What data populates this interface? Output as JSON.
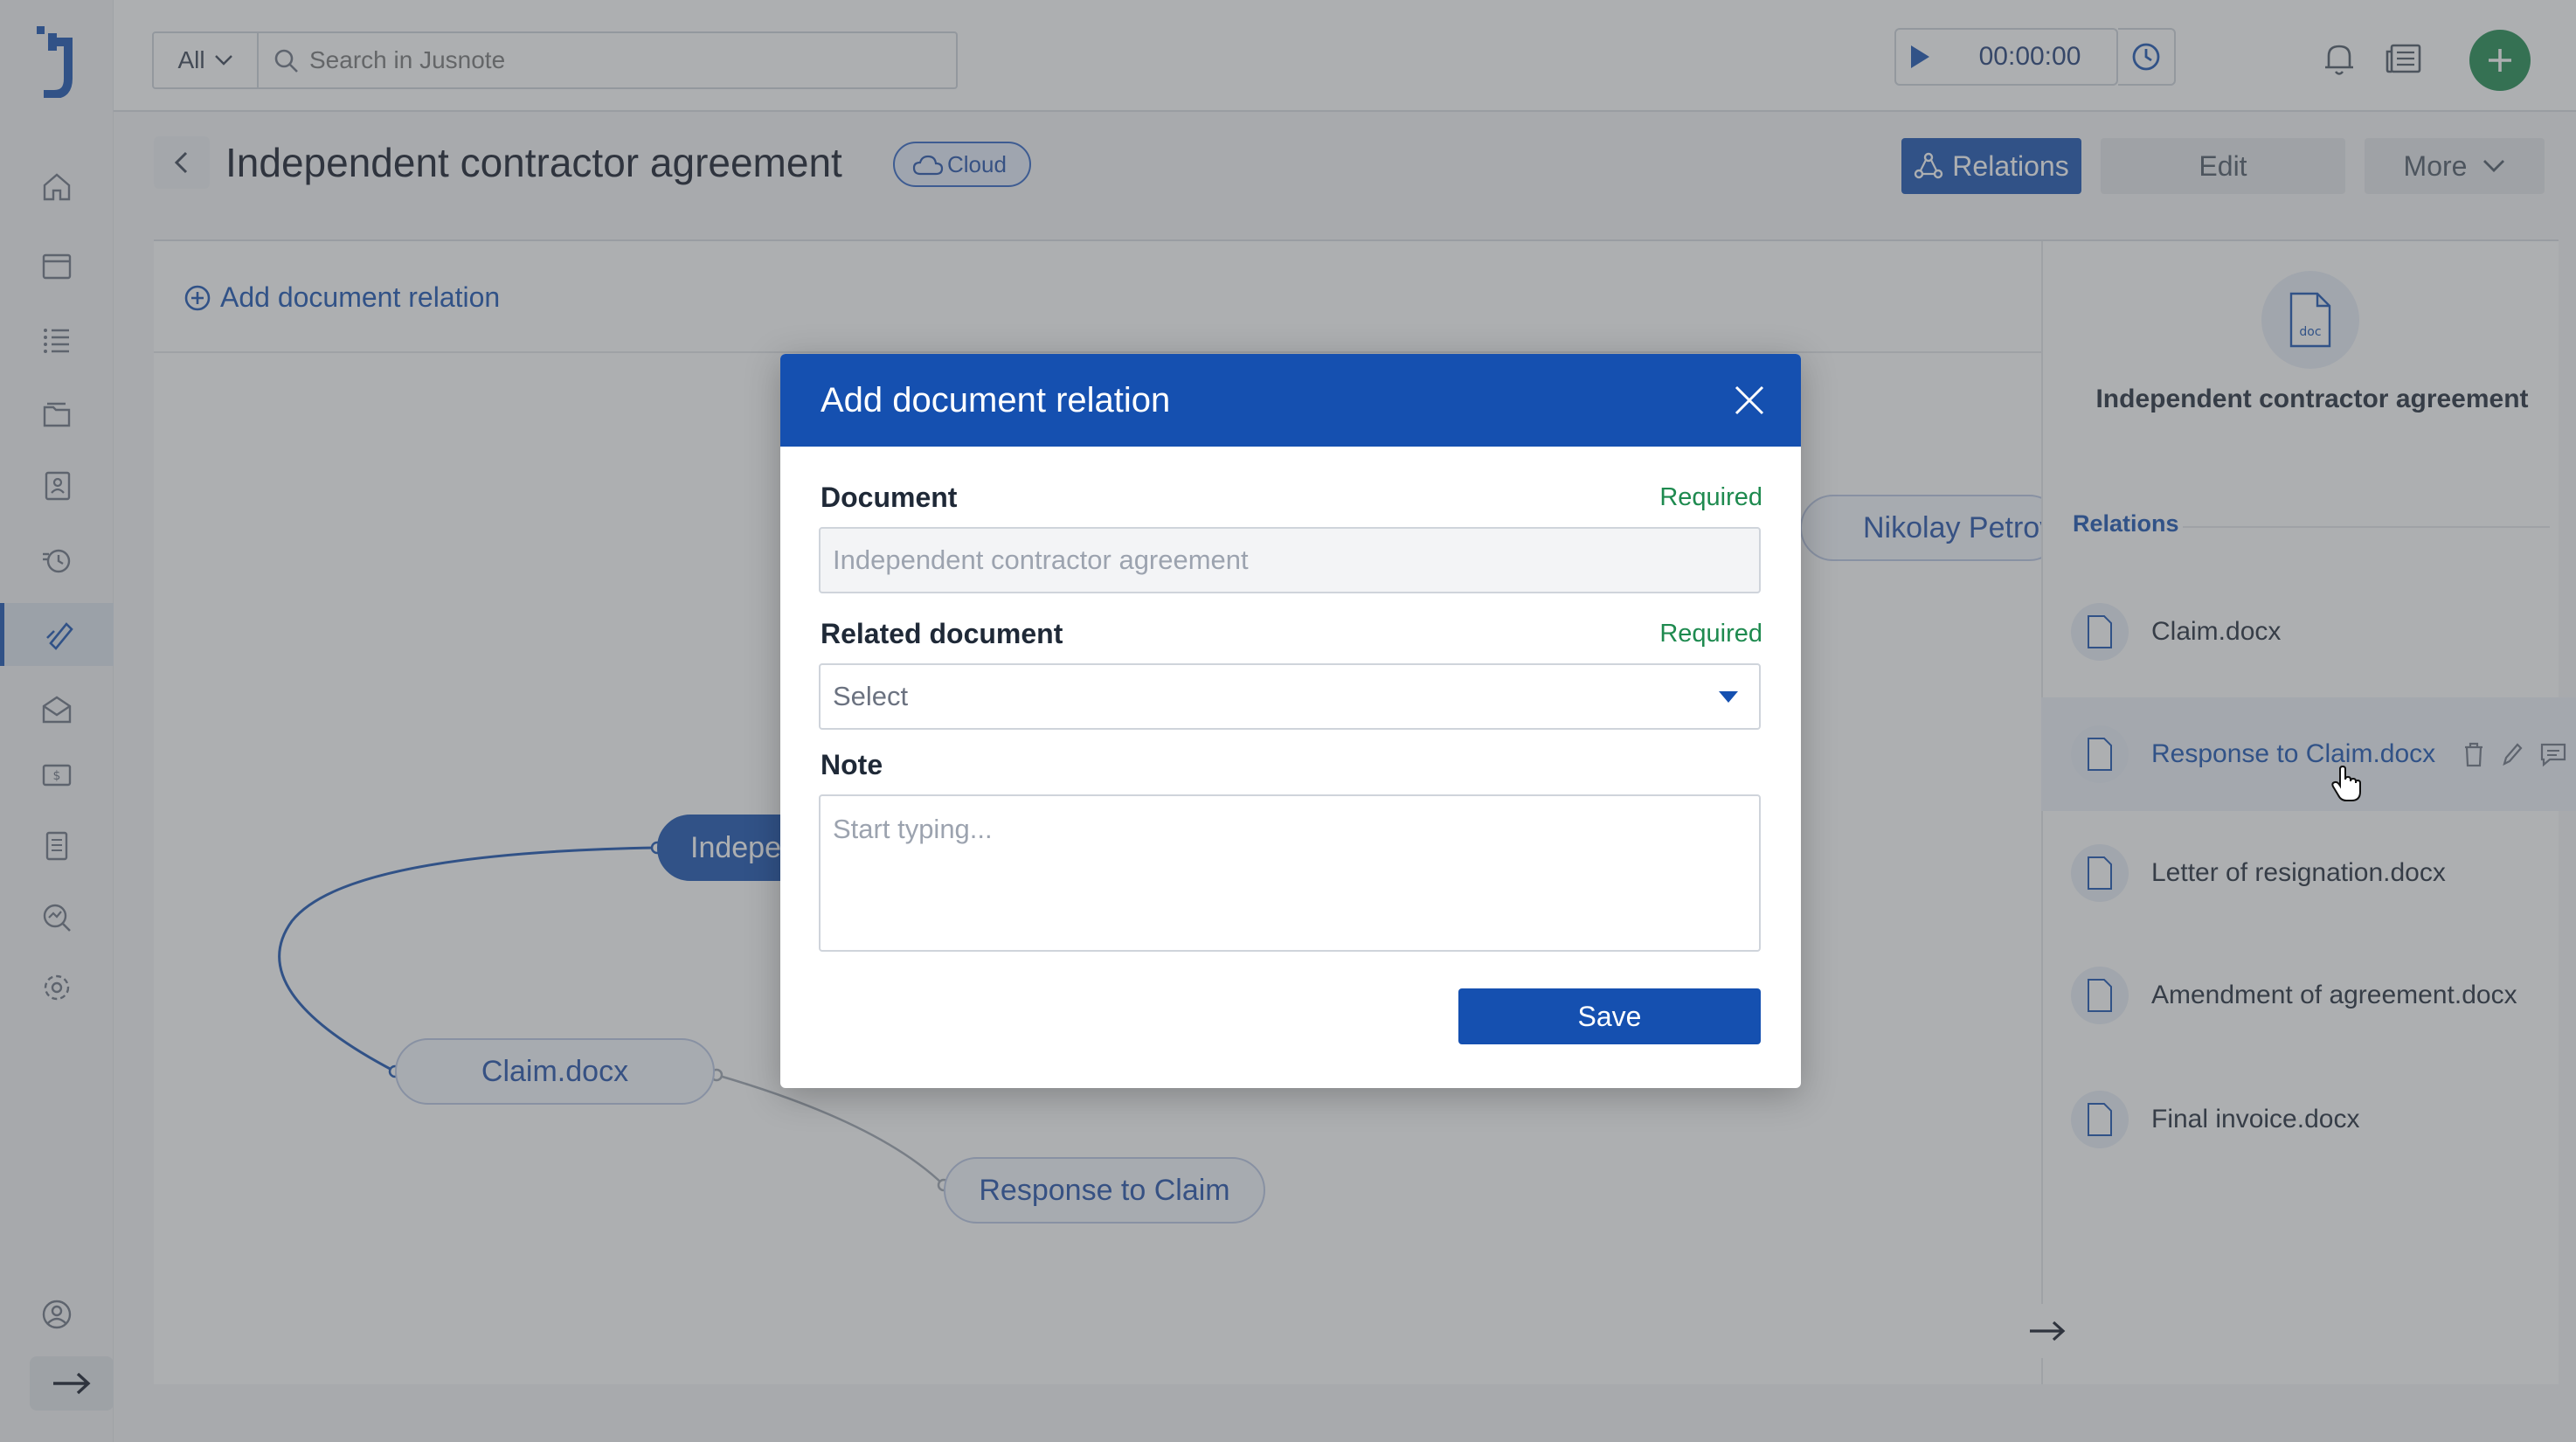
{
  "search": {
    "scope": "All",
    "placeholder": "Search in Jusnote"
  },
  "timer": {
    "value": "00:00:00"
  },
  "page": {
    "title": "Independent contractor agreement",
    "badge": "Cloud",
    "add_relation": "Add document relation",
    "actions": {
      "relations": "Relations",
      "edit": "Edit",
      "more": "More"
    }
  },
  "graph": {
    "nodes": {
      "main": "Indepe",
      "nikolay": "Nikolay Petrov",
      "claim": "Claim.docx",
      "response": "Response to Claim"
    }
  },
  "right_panel": {
    "title": "Independent contractor agreement",
    "doc_icon_label": "doc",
    "relations_label": "Relations",
    "items": [
      {
        "name": "Claim.docx"
      },
      {
        "name": "Response to Claim.docx"
      },
      {
        "name": "Letter of resignation.docx"
      },
      {
        "name": "Amendment of agreement.docx"
      },
      {
        "name": "Final invoice.docx"
      }
    ]
  },
  "modal": {
    "title": "Add document relation",
    "document": {
      "label": "Document",
      "required": "Required",
      "value": "Independent contractor agreement"
    },
    "related": {
      "label": "Related document",
      "required": "Required",
      "placeholder": "Select"
    },
    "note": {
      "label": "Note",
      "placeholder": "Start typing..."
    },
    "save": "Save"
  },
  "colors": {
    "primary": "#1550b0",
    "success": "#1e8a4f"
  }
}
